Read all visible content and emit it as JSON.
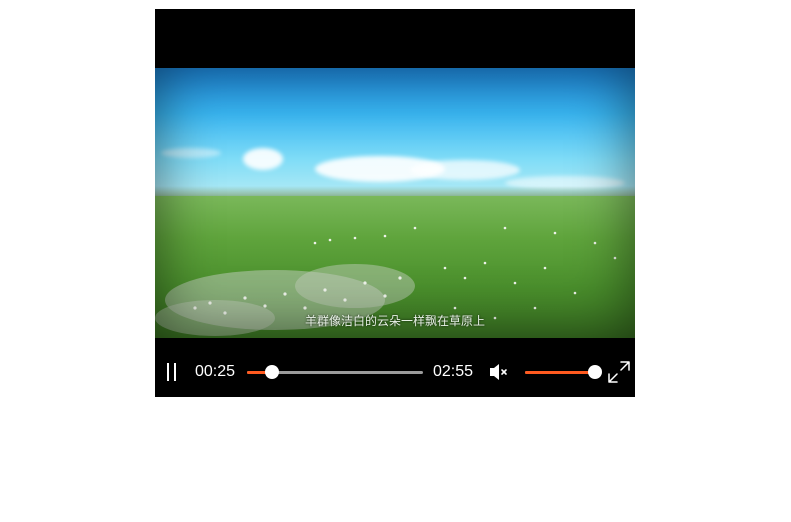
{
  "player": {
    "subtitle": "羊群像洁白的云朵一样飘在草原上",
    "current_time": "00:25",
    "duration": "02:55",
    "progress_fraction": 0.1429,
    "volume_fraction": 1.0,
    "state": "playing",
    "muted_icon": "speaker-mute-icon"
  },
  "colors": {
    "accent": "#ff5a1f",
    "track": "#9b9b9b",
    "background": "#000000"
  }
}
